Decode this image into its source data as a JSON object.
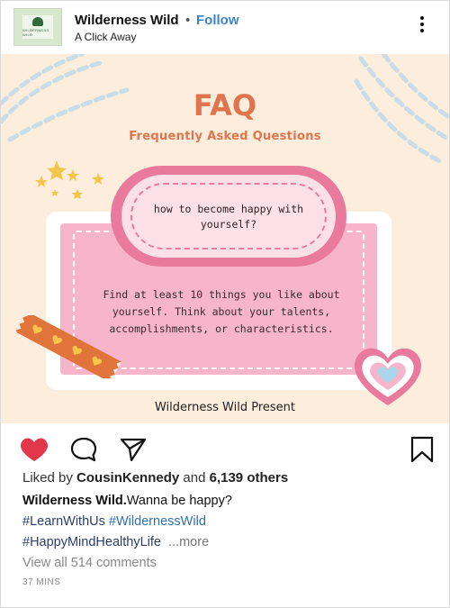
{
  "header": {
    "account_name": "Wilderness Wild",
    "separator": "•",
    "follow_label": "Follow",
    "subtitle": "A Click Away",
    "avatar_text": "WILDERNESS WILD"
  },
  "post": {
    "title": "FAQ",
    "subtitle": "Frequently Asked Questions",
    "question": "how to become happy with yourself?",
    "answer": "Find at least 10 things you like about yourself. Think about your talents, accomplishments, or characteristics.",
    "footer": "Wilderness Wild Present"
  },
  "actions": {
    "like_icon": "heart-filled-icon",
    "comment_icon": "comment-icon",
    "share_icon": "send-icon",
    "save_icon": "bookmark-icon",
    "like_color": "#e2364b"
  },
  "engagement": {
    "liked_prefix": "Liked by ",
    "liked_user": "CousinKennedy",
    "liked_middle": " and ",
    "liked_count": "6,139 others"
  },
  "caption": {
    "author": "Wilderness Wild.",
    "text": "Wanna be happy?",
    "tag1": "#LearnWithUs",
    "tag2": "#WildernessWild",
    "tag3": "#HappyMindHealthyLife",
    "more_label": "...more"
  },
  "comments_label": "View all 514 comments",
  "time_label": "37 MINS",
  "colors": {
    "accent_orange": "#e0744d",
    "pink": "#e9799d",
    "follow_blue": "#3b83c7",
    "background": "#fdeddc"
  }
}
